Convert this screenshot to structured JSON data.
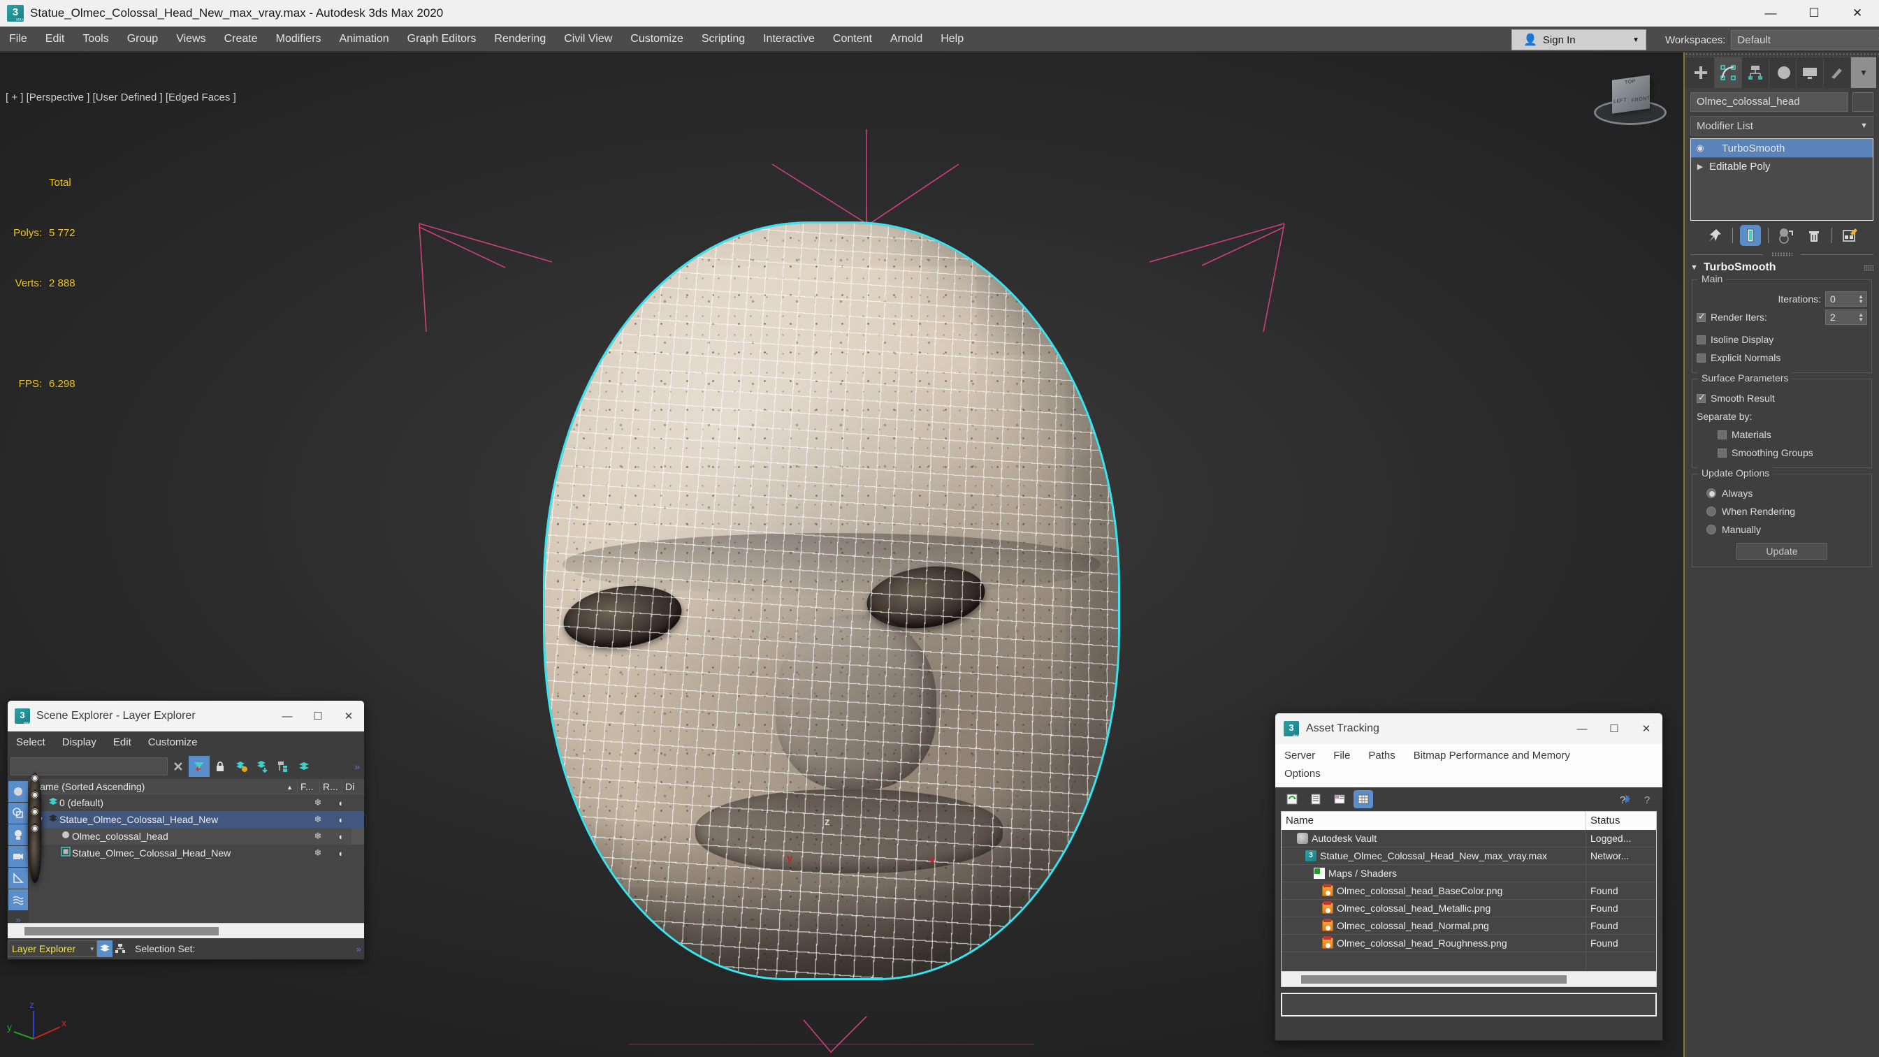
{
  "titlebar": {
    "title": "Statue_Olmec_Colossal_Head_New_max_vray.max - Autodesk 3ds Max 2020",
    "minimize": "—",
    "maximize": "☐",
    "close": "✕"
  },
  "menubar": {
    "items": [
      "File",
      "Edit",
      "Tools",
      "Group",
      "Views",
      "Create",
      "Modifiers",
      "Animation",
      "Graph Editors",
      "Rendering",
      "Civil View",
      "Customize",
      "Scripting",
      "Interactive",
      "Content",
      "Arnold",
      "Help"
    ]
  },
  "topright": {
    "sign_in": "Sign In",
    "person_icon": "●",
    "chevron": "▼",
    "workspaces_label": "Workspaces:",
    "workspace_value": "Default"
  },
  "viewport": {
    "label": "[ + ] [Perspective ] [User Defined ] [Edged Faces ]",
    "stats_header": "Total",
    "stats": [
      {
        "key": "Polys:",
        "value": "5 772"
      },
      {
        "key": "Verts:",
        "value": "2 888"
      }
    ],
    "fps_key": "FPS:",
    "fps_value": "6.298",
    "gizmo_axes": {
      "x": "x",
      "y": "y",
      "z": "z"
    },
    "tripod_axes": {
      "x": "x",
      "y": "y",
      "z": "z"
    },
    "viewcube": {
      "top": "TOP",
      "front": "FRONT",
      "left": "LEFT"
    },
    "selection_color": "#35e6f2",
    "gizmo_color": "#e0407f"
  },
  "command_panel": {
    "tabs": [
      {
        "name": "create-tab",
        "glyph": "+"
      },
      {
        "name": "modify-tab",
        "glyph": "◴"
      },
      {
        "name": "hierarchy-tab",
        "glyph": "⑂"
      },
      {
        "name": "motion-tab",
        "glyph": "◐"
      },
      {
        "name": "display-tab",
        "glyph": "▭"
      },
      {
        "name": "utilities-tab",
        "glyph": "⚒"
      }
    ],
    "more_chevron": "▼",
    "object_name": "Olmec_colossal_head",
    "modifier_list_label": "Modifier List",
    "modifier_list_chevron": "▼",
    "stack": [
      {
        "label": "TurboSmooth",
        "selected": true,
        "eye": "◉"
      },
      {
        "label": "Editable Poly",
        "selected": false,
        "arrow": "▶"
      }
    ],
    "stack_buttons": [
      {
        "name": "pin-stack-button",
        "glyph": "📌"
      },
      {
        "name": "show-end-result-button",
        "glyph": "▮"
      },
      {
        "name": "make-unique-button",
        "glyph": "◑"
      },
      {
        "name": "remove-modifier-button",
        "glyph": "🗑"
      },
      {
        "name": "configure-modifier-sets-button",
        "glyph": "✎"
      }
    ],
    "rollout": {
      "title": "TurboSmooth",
      "triangle": "▼",
      "main_group": "Main",
      "iterations_label": "Iterations:",
      "iterations_value": "0",
      "render_iters_label": "Render Iters:",
      "render_iters_value": "2",
      "render_iters_checked": true,
      "isoline_label": "Isoline Display",
      "isoline_checked": false,
      "explicit_normals_label": "Explicit Normals",
      "explicit_normals_checked": false,
      "surface_group": "Surface Parameters",
      "smooth_result_label": "Smooth Result",
      "smooth_result_checked": true,
      "separate_by_label": "Separate by:",
      "materials_label": "Materials",
      "materials_checked": false,
      "smoothing_groups_label": "Smoothing Groups",
      "smoothing_groups_checked": false,
      "update_group": "Update Options",
      "update_options": [
        {
          "label": "Always",
          "selected": true
        },
        {
          "label": "When Rendering",
          "selected": false
        },
        {
          "label": "Manually",
          "selected": false
        }
      ],
      "update_button": "Update"
    }
  },
  "scene_explorer": {
    "title": "Scene Explorer - Layer Explorer",
    "window_buttons": {
      "minimize": "—",
      "maximize": "☐",
      "close": "✕"
    },
    "menu": [
      "Select",
      "Display",
      "Edit",
      "Customize"
    ],
    "search_value": "",
    "search_placeholder": "",
    "toolbar": [
      {
        "name": "clear-search-icon",
        "glyph": "✕",
        "active": false
      },
      {
        "name": "filter-icon",
        "glyph": "▼",
        "active": true
      },
      {
        "name": "lock-icon",
        "glyph": "🔒",
        "active": false
      },
      {
        "name": "add-layer-icon",
        "glyph": "➕",
        "active": false
      },
      {
        "name": "layer-down-icon",
        "glyph": "≣",
        "active": false
      },
      {
        "name": "nest-layer-icon",
        "glyph": "⊞",
        "active": false
      },
      {
        "name": "layers-icon",
        "glyph": "≣",
        "active": false
      }
    ],
    "toolbar_overflow": "»",
    "sidebar": [
      {
        "name": "sidebar-geometry-icon",
        "glyph": "●"
      },
      {
        "name": "sidebar-shapes-icon",
        "glyph": "◎"
      },
      {
        "name": "sidebar-lights-icon",
        "glyph": "💡"
      },
      {
        "name": "sidebar-cameras-icon",
        "glyph": "🎥"
      },
      {
        "name": "sidebar-helpers-icon",
        "glyph": "◢"
      },
      {
        "name": "sidebar-spacewarps-icon",
        "glyph": "≋"
      }
    ],
    "sidebar_overflow": "»",
    "columns": [
      {
        "label": "Name (Sorted Ascending)",
        "sort": "▲"
      },
      {
        "label": "F..."
      },
      {
        "label": "R..."
      },
      {
        "label": "Di"
      }
    ],
    "rows": [
      {
        "name": "0 (default)",
        "indent": 1,
        "selected": false,
        "eye": "◉",
        "type_icon": "layers-icon",
        "freeze": "❄",
        "render": "◖"
      },
      {
        "name": "Statue_Olmec_Colossal_Head_New",
        "indent": 1,
        "selected": true,
        "eye": "◉",
        "type_icon": "layers-icon-dark",
        "freeze": "❄",
        "render": "◖",
        "expander": "▼"
      },
      {
        "name": "Olmec_colossal_head",
        "indent": 2,
        "selected": false,
        "eye": "◉",
        "type_icon": "mesh-icon",
        "freeze": "❄",
        "render": "◖"
      },
      {
        "name": "Statue_Olmec_Colossal_Head_New",
        "indent": 2,
        "selected": false,
        "eye": "◉",
        "type_icon": "group-icon",
        "freeze": "❄",
        "render": "◖"
      }
    ],
    "footer": {
      "mode": "Layer Explorer",
      "mode_chevron": "▾",
      "layer_icon": "≣",
      "hierarchy_icon": "⑂",
      "selection_set_label": "Selection Set:",
      "overflow": "»"
    }
  },
  "asset_tracking": {
    "title": "Asset Tracking",
    "window_buttons": {
      "minimize": "—",
      "maximize": "☐",
      "close": "✕"
    },
    "menu_row1": [
      "Server",
      "File",
      "Paths",
      "Bitmap Performance and Memory"
    ],
    "menu_row2": [
      "Options"
    ],
    "toolbar": [
      {
        "name": "refresh-icon",
        "glyph": "⟳",
        "active": false
      },
      {
        "name": "list-view-icon",
        "glyph": "☰",
        "active": false
      },
      {
        "name": "detail-view-icon",
        "glyph": "▤",
        "active": false
      },
      {
        "name": "grid-view-icon",
        "glyph": "▦",
        "active": true
      }
    ],
    "toolbar_right": [
      {
        "name": "help-new-icon",
        "glyph": "?"
      },
      {
        "name": "help-icon",
        "glyph": "?"
      }
    ],
    "columns": [
      "Name",
      "Status"
    ],
    "rows": [
      {
        "name": "Autodesk Vault",
        "status": "Logged...",
        "indent": 1,
        "icon": "vault-icon"
      },
      {
        "name": "Statue_Olmec_Colossal_Head_New_max_vray.max",
        "status": "Networ...",
        "indent": 2,
        "icon": "max-file-icon"
      },
      {
        "name": "Maps / Shaders",
        "status": "",
        "indent": 3,
        "icon": "maps-shaders-icon"
      },
      {
        "name": "Olmec_colossal_head_BaseColor.png",
        "status": "Found",
        "indent": 4,
        "icon": "png-file-icon"
      },
      {
        "name": "Olmec_colossal_head_Metallic.png",
        "status": "Found",
        "indent": 4,
        "icon": "png-file-icon"
      },
      {
        "name": "Olmec_colossal_head_Normal.png",
        "status": "Found",
        "indent": 4,
        "icon": "png-file-icon"
      },
      {
        "name": "Olmec_colossal_head_Roughness.png",
        "status": "Found",
        "indent": 4,
        "icon": "png-file-icon"
      }
    ],
    "status_field_value": ""
  }
}
